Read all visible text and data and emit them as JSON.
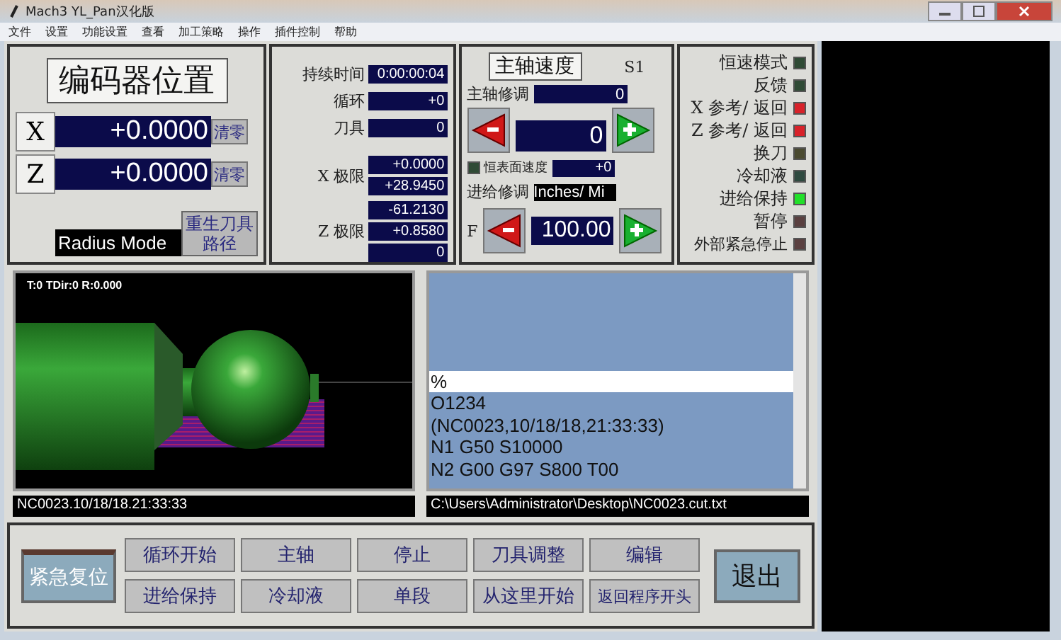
{
  "window": {
    "title": "Mach3 YL_Pan汉化版"
  },
  "menu": [
    "文件",
    "设置",
    "功能设置",
    "查看",
    "加工策略",
    "操作",
    "插件控制",
    "帮助"
  ],
  "encoder": {
    "title": "编码器位置",
    "mode": "Radius Mode",
    "regen_button": "重生刀具路径",
    "axes": [
      {
        "label": "X",
        "value": "+0.0000",
        "button": "清零"
      },
      {
        "label": "Z",
        "value": "+0.0000",
        "button": "清零"
      }
    ]
  },
  "status": {
    "rows": [
      {
        "label": "持续时间",
        "values": [
          "0:00:00:04"
        ]
      },
      {
        "label": "循环",
        "values": [
          "+0"
        ]
      },
      {
        "label": "刀具",
        "values": [
          "0"
        ]
      },
      {
        "label": "X 极限",
        "values": [
          "+0.0000",
          "+28.9450"
        ]
      },
      {
        "label": "Z 极限",
        "values": [
          "-61.2130",
          "+0.8580",
          "0"
        ]
      }
    ]
  },
  "spindle": {
    "title": "主轴速度",
    "tag": "S1",
    "override_label": "主轴修调",
    "override_value": "0",
    "speed": "0",
    "css_label": "恒表面速度",
    "css_value": "+0",
    "css_on": false,
    "feed_label": "进给修调",
    "feed_units": "Inches/ Mi",
    "feed_prefix": "F",
    "feed_value": "100.00"
  },
  "leds": [
    {
      "label": "恒速模式",
      "color": "#2f4a35"
    },
    {
      "label": "反馈",
      "color": "#2f4a35"
    },
    {
      "label": "X 参考/ 返回",
      "color": "#d8222a"
    },
    {
      "label": "Z 参考/ 返回",
      "color": "#d8222a"
    },
    {
      "label": "换刀",
      "color": "#4a4a30"
    },
    {
      "label": "冷却液",
      "color": "#2f4a40"
    },
    {
      "label": "进给保持",
      "color": "#22e02a"
    },
    {
      "label": "暂停",
      "color": "#5a4040"
    },
    {
      "label": "外部紧急停止",
      "color": "#5a4040"
    }
  ],
  "toolpath": {
    "info": "T:0 TDir:0 R:0.000",
    "file_label": "NC0023.10/18/18.21:33:33"
  },
  "gcode": {
    "path": "C:\\Users\\Administrator\\Desktop\\NC0023.cut.txt",
    "lines": [
      {
        "text": "%",
        "selected": true
      },
      {
        "text": "O1234",
        "selected": false
      },
      {
        "text": "(NC0023,10/18/18,21:33:33)",
        "selected": false
      },
      {
        "text": "N1 G50 S10000",
        "selected": false
      },
      {
        "text": "N2 G00 G97 S800 T00",
        "selected": false
      }
    ]
  },
  "controls": {
    "reset": "紧急复位",
    "exit": "退出",
    "buttons": [
      "循环开始",
      "主轴",
      "停止",
      "刀具调整",
      "编辑",
      "进给保持",
      "冷却液",
      "单段",
      "从这里开始",
      "返回程序开头"
    ]
  }
}
